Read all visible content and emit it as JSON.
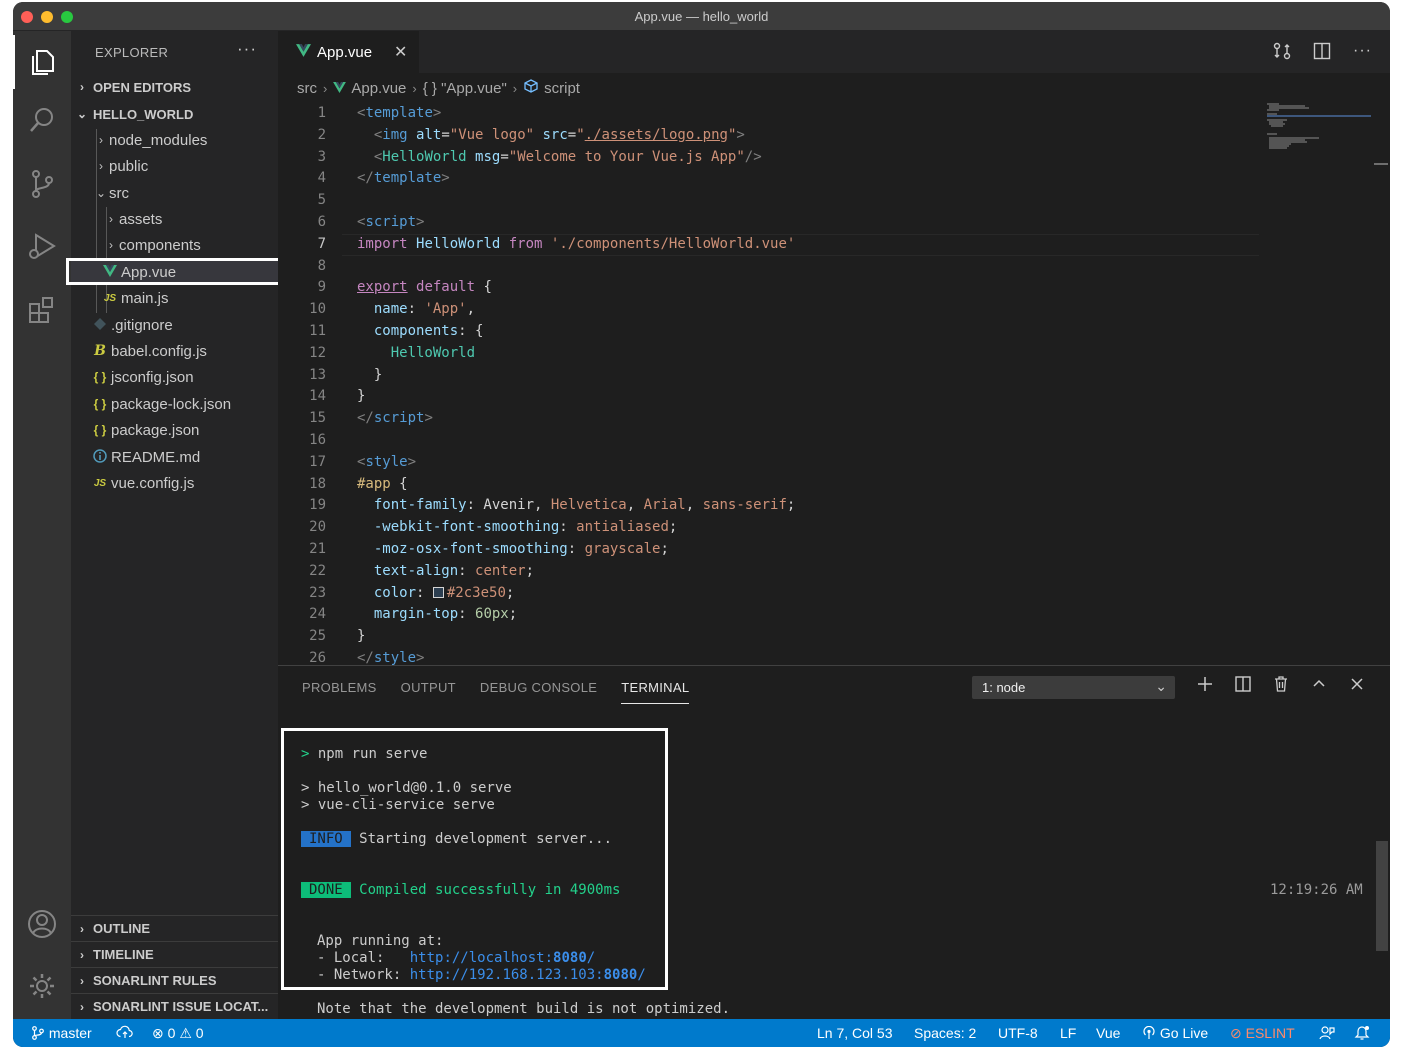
{
  "window": {
    "title": "App.vue — hello_world"
  },
  "sidebar": {
    "header": "EXPLORER",
    "more": "···",
    "open_editors": "OPEN EDITORS",
    "project": "HELLO_WORLD",
    "tree": [
      {
        "label": "node_modules",
        "type": "folder",
        "expanded": false
      },
      {
        "label": "public",
        "type": "folder",
        "expanded": false
      },
      {
        "label": "src",
        "type": "folder",
        "expanded": true
      },
      {
        "label": "assets",
        "type": "folder",
        "expanded": false
      },
      {
        "label": "components",
        "type": "folder",
        "expanded": false
      },
      {
        "label": "App.vue",
        "type": "vue-file",
        "selected": true
      },
      {
        "label": "main.js",
        "type": "js-file",
        "icon": "JS"
      },
      {
        "label": ".gitignore",
        "type": "git-file"
      },
      {
        "label": "babel.config.js",
        "type": "babel-file"
      },
      {
        "label": "jsconfig.json",
        "type": "json-file",
        "icon": "{ }"
      },
      {
        "label": "package-lock.json",
        "type": "json-file",
        "icon": "{ }"
      },
      {
        "label": "package.json",
        "type": "json-file",
        "icon": "{ }"
      },
      {
        "label": "README.md",
        "type": "info-file"
      },
      {
        "label": "vue.config.js",
        "type": "js-file",
        "icon": "JS"
      }
    ],
    "bottom_sections": [
      "OUTLINE",
      "TIMELINE",
      "SONARLINT RULES",
      "SONARLINT ISSUE LOCAT..."
    ]
  },
  "editor": {
    "tab": {
      "label": "App.vue",
      "close": "✕"
    },
    "breadcrumb": [
      "src",
      "App.vue",
      "{ } \"App.vue\"",
      "script"
    ],
    "current_line": 7,
    "line_numbers": [
      "1",
      "2",
      "3",
      "4",
      "5",
      "6",
      "7",
      "8",
      "9",
      "10",
      "11",
      "12",
      "13",
      "14",
      "15",
      "16",
      "17",
      "18",
      "19",
      "20",
      "21",
      "22",
      "23",
      "24",
      "25",
      "26"
    ],
    "color_value": "#2c3e50"
  },
  "panel": {
    "tabs": [
      "PROBLEMS",
      "OUTPUT",
      "DEBUG CONSOLE",
      "TERMINAL"
    ],
    "active_tab": "TERMINAL",
    "terminal_select": "1: node",
    "terminal": {
      "prompt": ">",
      "command": "npm run serve",
      "script_line1": "> hello_world@0.1.0 serve",
      "script_line2": "> vue-cli-service serve",
      "info_badge": "INFO",
      "info_text": "Starting development server...",
      "done_badge": "DONE",
      "done_text": "Compiled successfully in 4900ms",
      "timestamp": "12:19:26 AM",
      "running": "App running at:",
      "local_label": "- Local:",
      "local_url_prefix": "http://localhost:",
      "local_port": "8080",
      "url_suffix": "/",
      "network_label": "- Network:",
      "network_url_prefix": "http://192.168.123.103:",
      "network_port": "8080",
      "note": "Note that the development build is not optimized."
    }
  },
  "statusbar": {
    "branch": "master",
    "errors": "0",
    "warnings": "0",
    "position": "Ln 7, Col 53",
    "spaces": "Spaces: 2",
    "encoding": "UTF-8",
    "eol": "LF",
    "language": "Vue",
    "golive": "Go Live",
    "eslint": "ESLINT"
  },
  "colors": {
    "accent": "#007acc",
    "highlight_border": "#ffffff"
  }
}
